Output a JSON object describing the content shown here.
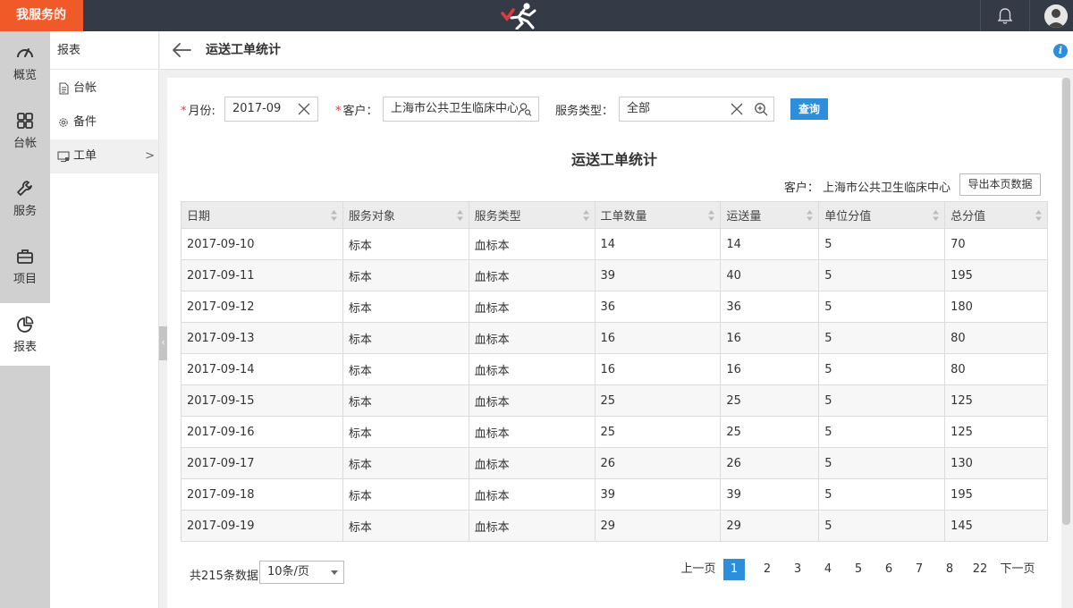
{
  "topbar": {
    "brand": "我服务的",
    "logo_icon": "runner-logo-icon",
    "bell_icon": "bell-icon",
    "avatar_icon": "user-avatar-icon"
  },
  "rail": [
    {
      "label": "概览",
      "icon": "gauge-icon"
    },
    {
      "label": "台帐",
      "icon": "grid-icon"
    },
    {
      "label": "服务",
      "icon": "wrench-icon"
    },
    {
      "label": "项目",
      "icon": "briefcase-icon"
    },
    {
      "label": "报表",
      "icon": "pie-chart-icon",
      "active": true
    }
  ],
  "subnav": {
    "title": "报表",
    "items": [
      {
        "label": "台帐",
        "icon": "document-icon"
      },
      {
        "label": "备件",
        "icon": "gear-icon"
      },
      {
        "label": "工单",
        "icon": "monitor-icon",
        "active": true
      }
    ]
  },
  "header": {
    "title": "运送工单统计"
  },
  "filters": {
    "month_label": "月份:",
    "month_value": "2017-09",
    "client_label": "客户：",
    "client_value": "上海市公共卫生临床中心",
    "type_label": "服务类型：",
    "type_value": "全部",
    "query_label": "查询"
  },
  "report": {
    "title": "运送工单统计",
    "client_text": "客户： 上海市公共卫生临床中心",
    "export_label": "导出本页数据"
  },
  "table": {
    "columns": [
      "日期",
      "服务对象",
      "服务类型",
      "工单数量",
      "运送量",
      "单位分值",
      "总分值"
    ],
    "rows": [
      [
        "2017-09-10",
        "标本",
        "血标本",
        "14",
        "14",
        "5",
        "70"
      ],
      [
        "2017-09-11",
        "标本",
        "血标本",
        "39",
        "40",
        "5",
        "195"
      ],
      [
        "2017-09-12",
        "标本",
        "血标本",
        "36",
        "36",
        "5",
        "180"
      ],
      [
        "2017-09-13",
        "标本",
        "血标本",
        "16",
        "16",
        "5",
        "80"
      ],
      [
        "2017-09-14",
        "标本",
        "血标本",
        "16",
        "16",
        "5",
        "80"
      ],
      [
        "2017-09-15",
        "标本",
        "血标本",
        "25",
        "25",
        "5",
        "125"
      ],
      [
        "2017-09-16",
        "标本",
        "血标本",
        "25",
        "25",
        "5",
        "125"
      ],
      [
        "2017-09-17",
        "标本",
        "血标本",
        "26",
        "26",
        "5",
        "130"
      ],
      [
        "2017-09-18",
        "标本",
        "血标本",
        "39",
        "39",
        "5",
        "195"
      ],
      [
        "2017-09-19",
        "标本",
        "血标本",
        "29",
        "29",
        "5",
        "145"
      ]
    ]
  },
  "pagination": {
    "total": "共215条数据",
    "page_size": "10条/页",
    "prev": "上一页",
    "pages": [
      "1",
      "2",
      "3",
      "4",
      "5",
      "6",
      "7",
      "8",
      "22"
    ],
    "current": "1",
    "next": "下一页"
  },
  "colors": {
    "brand": "#f05a28",
    "topbar": "#353a47",
    "accent": "#2d8fdc",
    "required": "#e4393c"
  }
}
